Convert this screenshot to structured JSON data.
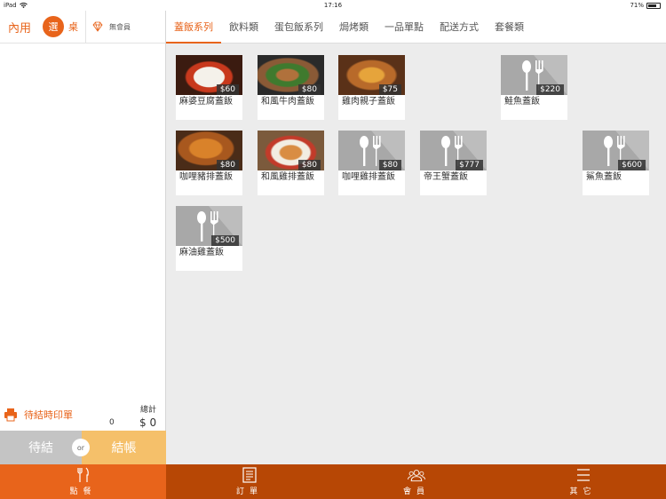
{
  "status": {
    "device": "iPad",
    "time": "17:16",
    "battery": "71%"
  },
  "left": {
    "mode": "內用",
    "select": "選",
    "table": "桌",
    "member": "無會員",
    "print_label": "待結時印單",
    "total_title": "總計",
    "count": "0",
    "amount": "$ 0",
    "hold_button": "待結",
    "or_label": "or",
    "pay_button": "結帳"
  },
  "tabs": [
    "蓋飯系列",
    "飲料類",
    "蛋包飯系列",
    "焗烤類",
    "一品單點",
    "配送方式",
    "套餐類"
  ],
  "items": [
    {
      "name": "麻婆豆腐蓋飯",
      "price": "$60"
    },
    {
      "name": "和風牛肉蓋飯",
      "price": "$80"
    },
    {
      "name": "雞肉親子蓋飯",
      "price": "$75"
    },
    {
      "name": "鮭魚蓋飯",
      "price": "$220"
    },
    {
      "name": "咖哩豬排蓋飯",
      "price": "$80"
    },
    {
      "name": "和風雞排蓋飯",
      "price": "$80"
    },
    {
      "name": "咖哩雞排蓋飯",
      "price": "$80"
    },
    {
      "name": "帝王蟹蓋飯",
      "price": "$777"
    },
    {
      "name": "鯊魚蓋飯",
      "price": "$600"
    },
    {
      "name": "麻油雞蓋飯",
      "price": "$500"
    }
  ],
  "nav": [
    "點餐",
    "訂單",
    "會員",
    "其它"
  ],
  "colors": {
    "accent": "#e8641b",
    "nav_bg": "#b74705",
    "pay": "#f5c06a",
    "hold": "#c4c4c4"
  }
}
